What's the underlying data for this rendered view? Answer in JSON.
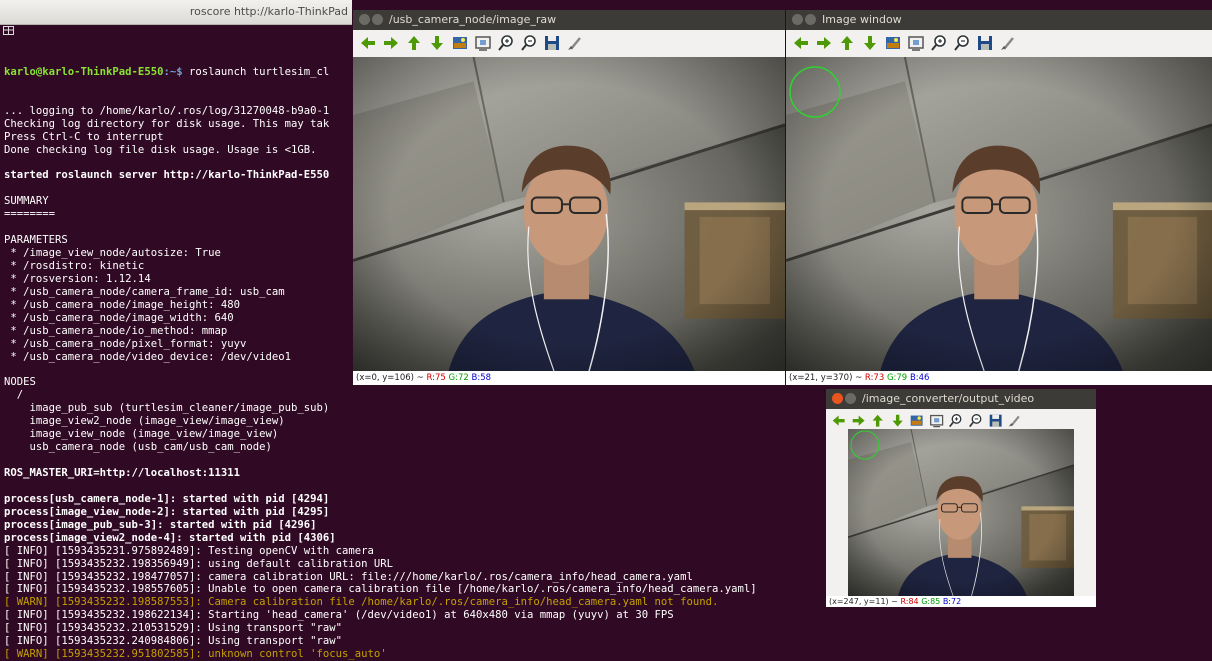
{
  "terminal": {
    "title": "roscore http://karlo-ThinkPad",
    "prompt_user": "karlo@karlo-ThinkPad-E550",
    "prompt_path": ":~$",
    "command": " roslaunch turtlesim_cl",
    "lines": [
      {
        "text": "... logging to /home/karlo/.ros/log/31270048-b9a0-1",
        "style": ""
      },
      {
        "text": "Checking log directory for disk usage. This may tak",
        "style": ""
      },
      {
        "text": "Press Ctrl-C to interrupt",
        "style": ""
      },
      {
        "text": "Done checking log file disk usage. Usage is <1GB.",
        "style": ""
      },
      {
        "text": "",
        "style": ""
      },
      {
        "text": "started roslaunch server http://karlo-ThinkPad-E550",
        "style": "bold"
      },
      {
        "text": "",
        "style": ""
      },
      {
        "text": "SUMMARY",
        "style": ""
      },
      {
        "text": "========",
        "style": ""
      },
      {
        "text": "",
        "style": ""
      },
      {
        "text": "PARAMETERS",
        "style": ""
      },
      {
        "text": " * /image_view_node/autosize: True",
        "style": ""
      },
      {
        "text": " * /rosdistro: kinetic",
        "style": ""
      },
      {
        "text": " * /rosversion: 1.12.14",
        "style": ""
      },
      {
        "text": " * /usb_camera_node/camera_frame_id: usb_cam",
        "style": ""
      },
      {
        "text": " * /usb_camera_node/image_height: 480",
        "style": ""
      },
      {
        "text": " * /usb_camera_node/image_width: 640",
        "style": ""
      },
      {
        "text": " * /usb_camera_node/io_method: mmap",
        "style": ""
      },
      {
        "text": " * /usb_camera_node/pixel_format: yuyv",
        "style": ""
      },
      {
        "text": " * /usb_camera_node/video_device: /dev/video1",
        "style": ""
      },
      {
        "text": "",
        "style": ""
      },
      {
        "text": "NODES",
        "style": ""
      },
      {
        "text": "  /",
        "style": ""
      },
      {
        "text": "    image_pub_sub (turtlesim_cleaner/image_pub_sub)",
        "style": ""
      },
      {
        "text": "    image_view2_node (image_view/image_view)",
        "style": ""
      },
      {
        "text": "    image_view_node (image_view/image_view)",
        "style": ""
      },
      {
        "text": "    usb_camera_node (usb_cam/usb_cam_node)",
        "style": ""
      },
      {
        "text": "",
        "style": ""
      },
      {
        "text": "ROS_MASTER_URI=http://localhost:11311",
        "style": "bold"
      },
      {
        "text": "",
        "style": ""
      },
      {
        "text": "process[usb_camera_node-1]: started with pid [4294]",
        "style": "bold"
      },
      {
        "text": "process[image_view_node-2]: started with pid [4295]",
        "style": "bold"
      },
      {
        "text": "process[image_pub_sub-3]: started with pid [4296]",
        "style": "bold"
      },
      {
        "text": "process[image_view2_node-4]: started with pid [4306]",
        "style": "bold"
      },
      {
        "text": "[ INFO] [1593435231.975892489]: Testing openCV with camera",
        "style": ""
      },
      {
        "text": "[ INFO] [1593435232.198356949]: using default calibration URL",
        "style": ""
      },
      {
        "text": "[ INFO] [1593435232.198477057]: camera calibration URL: file:///home/karlo/.ros/camera_info/head_camera.yaml",
        "style": ""
      },
      {
        "text": "[ INFO] [1593435232.198557605]: Unable to open camera calibration file [/home/karlo/.ros/camera_info/head_camera.yaml]",
        "style": ""
      },
      {
        "text": "[ WARN] [1593435232.198587553]: Camera calibration file /home/karlo/.ros/camera_info/head_camera.yaml not found.",
        "style": "warn"
      },
      {
        "text": "[ INFO] [1593435232.198622134]: Starting 'head_camera' (/dev/video1) at 640x480 via mmap (yuyv) at 30 FPS",
        "style": ""
      },
      {
        "text": "[ INFO] [1593435232.210531529]: Using transport \"raw\"",
        "style": ""
      },
      {
        "text": "[ INFO] [1593435232.240984806]: Using transport \"raw\"",
        "style": ""
      },
      {
        "text": "[ WARN] [1593435232.951802585]: unknown control 'focus_auto'",
        "style": "warn"
      }
    ]
  },
  "windows": {
    "raw": {
      "title": "/usb_camera_node/image_raw",
      "status_pos": "(x=0, y=106) ~ ",
      "r": "R:75",
      "g": "G:72",
      "b": "B:58"
    },
    "image": {
      "title": "Image window",
      "status_pos": "(x=21, y=370) ~ ",
      "r": "R:73",
      "g": "G:79",
      "b": "B:46"
    },
    "output": {
      "title": "/image_converter/output_video",
      "status_pos": "(x=247, y=11) ~ ",
      "r": "R:84",
      "g": "G:85",
      "b": "B:72"
    }
  },
  "toolbar_icons": [
    "arrow-left-icon",
    "arrow-right-icon",
    "arrow-up-icon",
    "arrow-down-icon",
    "image-icon",
    "panel-icon",
    "zoom-in-icon",
    "zoom-out-icon",
    "save-icon",
    "brush-icon"
  ],
  "colors": {
    "terminal_bg": "#300a24",
    "titlebar": "#3c3b37",
    "close_button": "#e9541f",
    "circle_overlay": "#2fd32f"
  }
}
